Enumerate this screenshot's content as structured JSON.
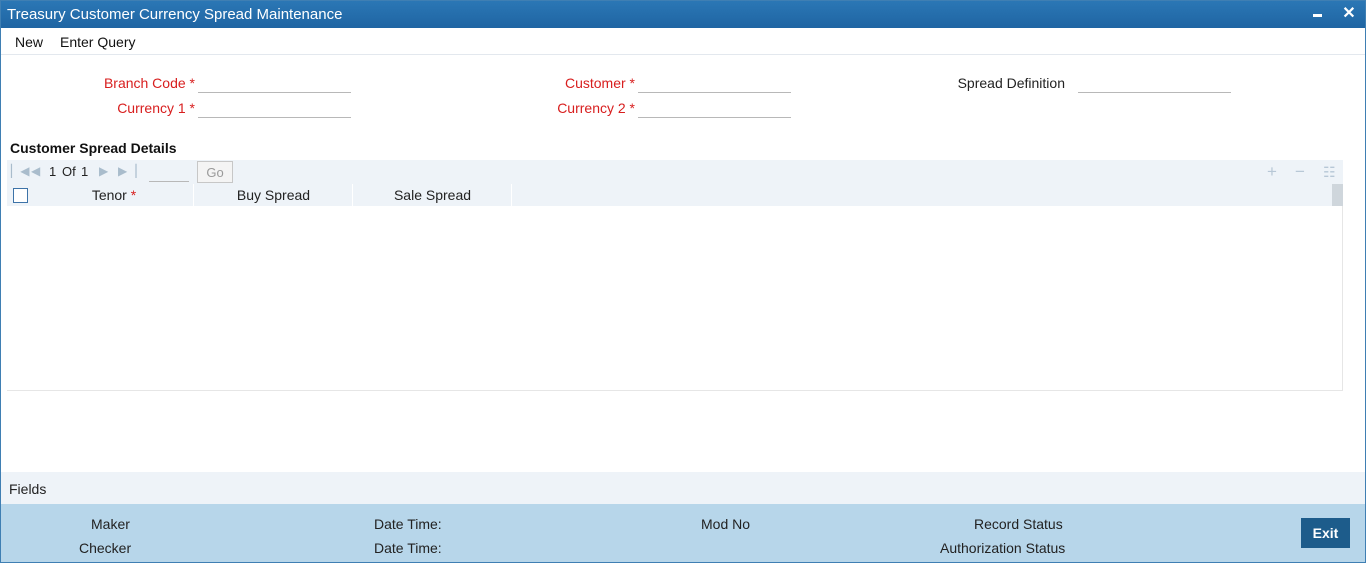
{
  "window": {
    "title": "Treasury Customer Currency Spread Maintenance",
    "minimize_icon": "minimize-icon",
    "close_icon": "close-icon",
    "close_glyph": "✕"
  },
  "menu": {
    "new_label": "New",
    "enter_query_label": "Enter Query"
  },
  "form": {
    "branch_code": {
      "label": "Branch Code *",
      "value": ""
    },
    "currency1": {
      "label": "Currency 1 *",
      "value": ""
    },
    "customer": {
      "label": "Customer *",
      "value": ""
    },
    "currency2": {
      "label": "Currency 2 *",
      "value": ""
    },
    "spread_definition": {
      "label": "Spread Definition",
      "value": ""
    }
  },
  "spread_details": {
    "title": "Customer Spread Details",
    "pager": {
      "current": "1",
      "of_label": "Of",
      "total": "1",
      "go_label": "Go",
      "page_input": ""
    },
    "columns": [
      {
        "label": "Tenor",
        "required_mark": "*"
      },
      {
        "label": "Buy Spread"
      },
      {
        "label": "Sale Spread"
      }
    ],
    "rows": []
  },
  "fields_bar": {
    "label": "Fields"
  },
  "footer": {
    "maker": "Maker",
    "checker": "Checker",
    "date_time_1": "Date Time:",
    "date_time_2": "Date Time:",
    "mod_no": "Mod No",
    "record_status": "Record Status",
    "authorization_status": "Authorization Status",
    "exit_label": "Exit"
  },
  "colors": {
    "title_bar": "#1f65a3",
    "required_label": "#d81e1e",
    "footer_bg": "#b7d6ea",
    "exit_button": "#1d5c8b"
  }
}
